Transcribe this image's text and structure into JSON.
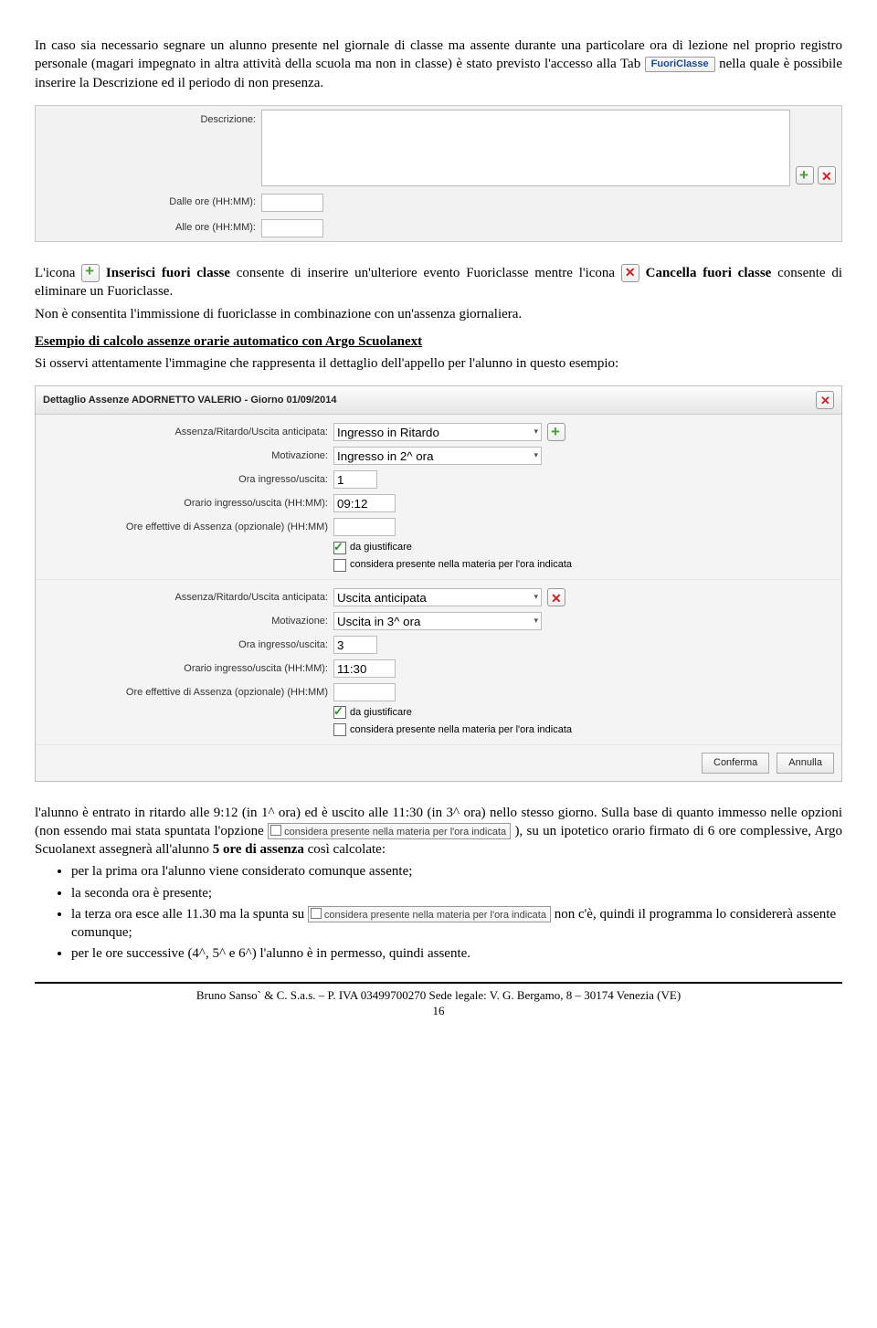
{
  "intro": {
    "p1a": "In caso sia necessario segnare un alunno presente nel giornale di classe ma assente durante una particolare ora di lezione nel proprio registro personale (magari impegnato in altra attività della scuola ma non in classe) è stato previsto l'accesso alla Tab ",
    "tab_label": "FuoriClasse",
    "p1b": " nella quale è possibile inserire la Descrizione ed il periodo di non presenza."
  },
  "desc_form": {
    "lbl_desc": "Descrizione:",
    "lbl_from": "Dalle ore (HH:MM):",
    "lbl_to": "Alle ore (HH:MM):"
  },
  "mid": {
    "p1a": "L'icona ",
    "p1b": " ",
    "insert_bold": "Inserisci fuori classe",
    "p1c": " consente di inserire un'ulteriore evento Fuoriclasse mentre l'icona ",
    "p1d": " ",
    "cancel_bold": "Cancella fuori classe",
    "p1e": " consente di eliminare un Fuoriclasse.",
    "p2": "Non è consentita l'immissione di fuoriclasse in combinazione con un'assenza giornaliera.",
    "hdr": "Esempio di calcolo assenze orarie automatico con Argo Scuolanext",
    "p3": "Si osservi attentamente l'immagine che rappresenta il dettaglio dell'appello per l'alunno in questo esempio:"
  },
  "dialog": {
    "title": "Dettaglio Assenze ADORNETTO VALERIO - Giorno 01/09/2014",
    "fields": {
      "assenza": "Assenza/Ritardo/Uscita anticipata:",
      "motivazione": "Motivazione:",
      "ora_iu": "Ora ingresso/uscita:",
      "orario": "Orario ingresso/uscita (HH:MM):",
      "ore_eff": "Ore effettive di Assenza (opzionale) (HH:MM)",
      "chk1": "da giustificare",
      "chk2": "considera presente nella materia per l'ora indicata"
    },
    "sec1": {
      "assenza_val": "Ingresso in Ritardo",
      "motiv_val": "Ingresso in 2^ ora",
      "ora_val": "1",
      "orario_val": "09:12"
    },
    "sec2": {
      "assenza_val": "Uscita anticipata",
      "motiv_val": "Uscita in 3^ ora",
      "ora_val": "3",
      "orario_val": "11:30"
    },
    "buttons": {
      "confirm": "Conferma",
      "cancel": "Annulla"
    }
  },
  "after": {
    "p1a": "l'alunno è entrato in ritardo alle 9:12 (in 1^ ora) ed è uscito alle 11:30 (in 3^ ora) nello stesso giorno. Sulla base di quanto immesso nelle opzioni (non essendo mai stata spuntata l'opzione ",
    "opt_label": "considera presente nella materia per l'ora indicata",
    "p1b": "), su un ipotetico orario firmato di 6 ore complessive, Argo Scuolanext assegnerà all'alunno ",
    "bold5": "5 ore di assenza",
    "p1c": " così calcolate:",
    "b1": "per la prima ora l'alunno viene considerato comunque assente;",
    "b2": "la seconda ora è presente;",
    "b3a": "la terza ora esce alle 11.30 ma la spunta su ",
    "b3b": " non c'è, quindi il programma lo considererà assente comunque;",
    "b4": "per le ore successive (4^, 5^ e 6^) l'alunno è in permesso, quindi assente."
  },
  "footer": {
    "line1": "Bruno Sanso` & C. S.a.s. – P. IVA 03499700270 Sede legale: V. G. Bergamo, 8 – 30174 Venezia (VE)",
    "page": "16"
  }
}
